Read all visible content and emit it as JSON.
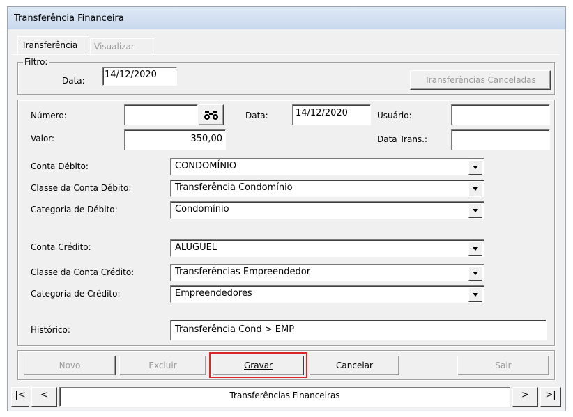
{
  "window": {
    "title": "Transferência Financeira"
  },
  "tabs": {
    "transfer": "Transferência",
    "view": "Visualizar"
  },
  "filter": {
    "legend": "Filtro:",
    "date_label": "Data:",
    "date_value": "14/12/2020",
    "canceled_button": "Transferências Canceladas"
  },
  "form": {
    "number_label": "Número:",
    "number_value": "",
    "date_label": "Data:",
    "date_value": "14/12/2020",
    "user_label": "Usuário:",
    "user_value": "",
    "value_label": "Valor:",
    "value_value": "350,00",
    "transfer_date_label": "Data Trans.:",
    "transfer_date_value": "",
    "debit_account_label": "Conta Débito:",
    "debit_account_value": "CONDOMÍNIO",
    "debit_class_label": "Classe da Conta Débito:",
    "debit_class_value": "Transferência Condomínio",
    "debit_category_label": "Categoria de Débito:",
    "debit_category_value": "Condomínio",
    "credit_account_label": "Conta Crédito:",
    "credit_account_value": "ALUGUEL",
    "credit_class_label": "Classe da Conta Crédito:",
    "credit_class_value": "Transferências Empreendedor",
    "credit_category_label": "Categoria de Crédito:",
    "credit_category_value": "Empreendedores",
    "history_label": "Histórico:",
    "history_value": "Transferência Cond > EMP"
  },
  "buttons": {
    "new": "Novo",
    "delete": "Excluir",
    "save": "Gravar",
    "cancel": "Cancelar",
    "exit": "Sair"
  },
  "navigator": {
    "first": "|<",
    "prev": "<",
    "caption": "Transferências Financeiras",
    "next": ">",
    "last": ">|"
  },
  "colors": {
    "highlight": "#d9262b",
    "disabled_text": "#9a9a9a"
  }
}
